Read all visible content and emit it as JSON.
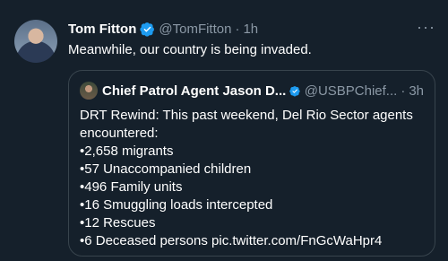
{
  "tweet": {
    "name": "Tom Fitton",
    "handle": "@TomFitton",
    "separator": "·",
    "time": "1h",
    "more": "···",
    "text": "Meanwhile, our country is being invaded."
  },
  "quote": {
    "name": "Chief Patrol Agent Jason D...",
    "handle": "@USBPChief...",
    "separator": "·",
    "time": "3h",
    "lines": [
      "DRT Rewind: This past weekend, Del Rio Sector agents",
      "encountered:",
      "•2,658 migrants",
      "•57 Unaccompanied children",
      "•496 Family units",
      "•16 Smuggling loads intercepted",
      "•12 Rescues"
    ],
    "last_line_text": "•6 Deceased persons ",
    "link": "pic.twitter.com/FnGcWaHpr4"
  },
  "colors": {
    "background": "#15202b",
    "secondary_text": "#8b98a5",
    "verified": "#1d9bf0",
    "border": "#38444d"
  }
}
